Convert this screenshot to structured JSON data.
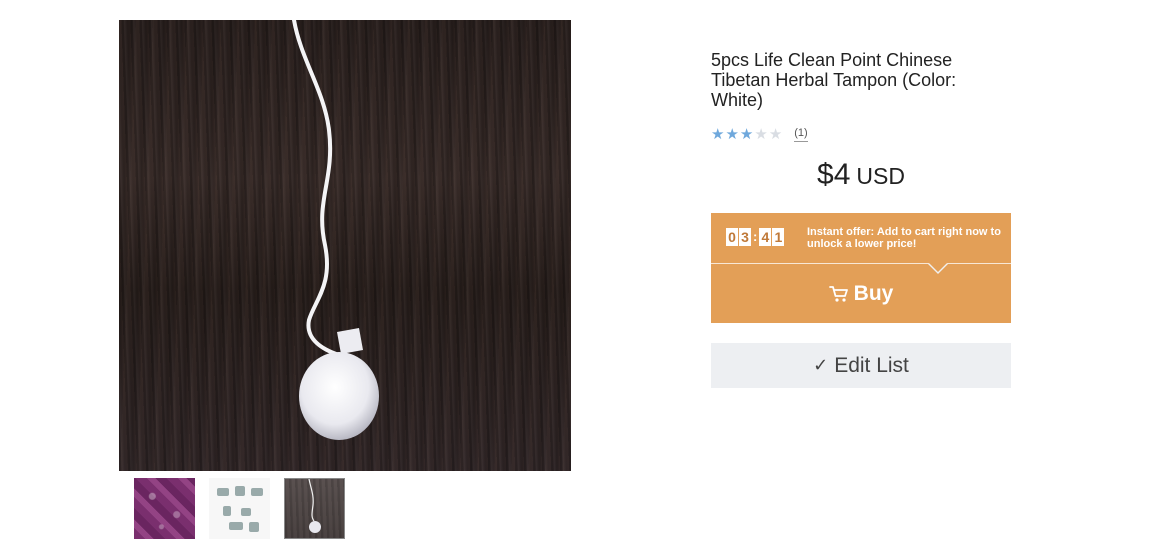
{
  "product": {
    "title": "5pcs Life Clean Point Chinese Tibetan Herbal Tampon (Color: White)",
    "rating": {
      "stars_filled": 3,
      "stars_total": 5,
      "review_count": "(1)"
    },
    "price": {
      "amount": "$4",
      "currency": "USD"
    }
  },
  "offer": {
    "timer_digits": [
      "0",
      "3",
      "4",
      "1"
    ],
    "timer_separator": ":",
    "message": "Instant offer: Add to cart right now to unlock a lower price!",
    "buy_label": "Buy",
    "buy_icon": "cart-icon"
  },
  "edit_list": {
    "label": "Edit List",
    "icon": "checkmark-icon"
  },
  "gallery": {
    "main_image": "white-herbal-tampon-on-wood",
    "thumbnails": [
      "purple-packages",
      "instruction-diagram",
      "white-herbal-tampon-on-wood"
    ],
    "selected_thumbnail": 3
  },
  "colors": {
    "accent_orange": "#e39f57",
    "star_blue": "#6fa8dc",
    "button_gray": "#edeff2"
  }
}
